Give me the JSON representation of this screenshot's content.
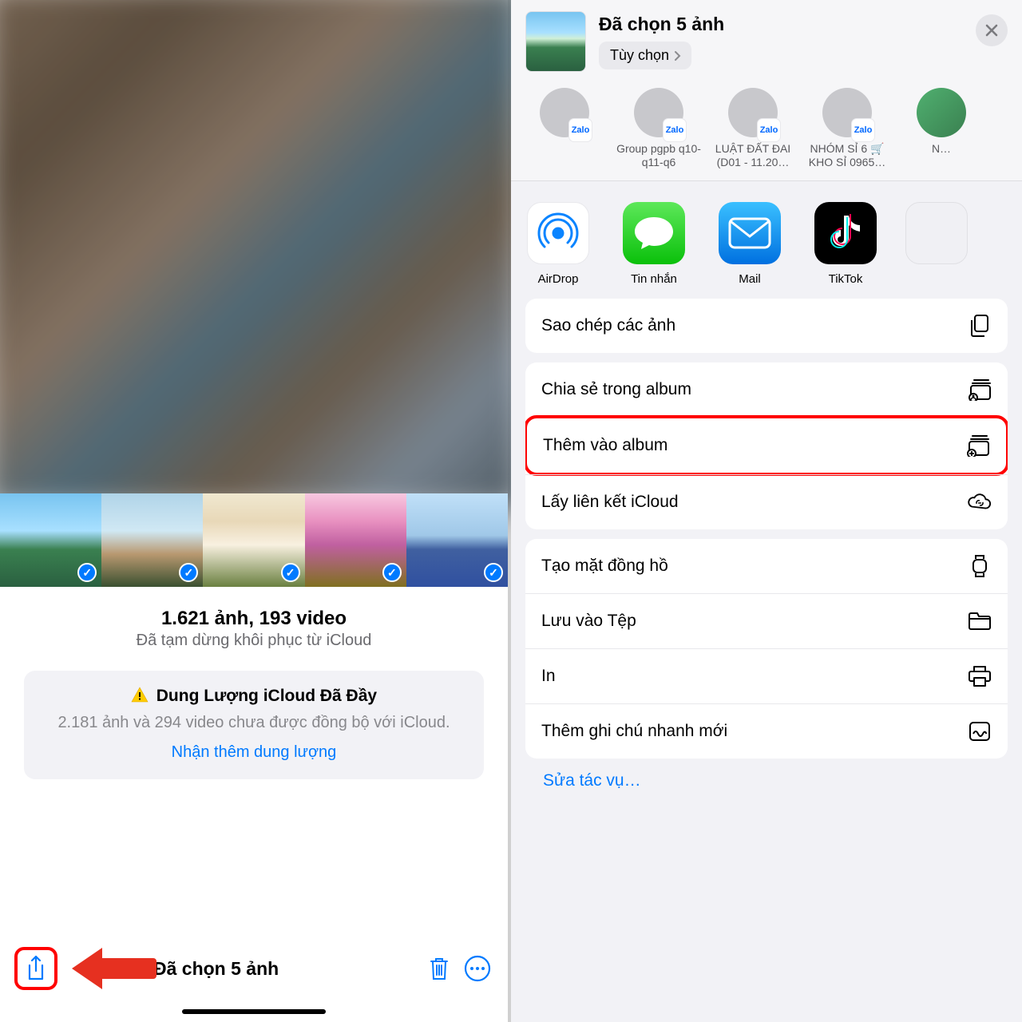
{
  "left": {
    "count_main": "1.621 ảnh, 193 video",
    "count_sub": "Đã tạm dừng khôi phục từ iCloud",
    "alert_title": "Dung Lượng iCloud Đã Đầy",
    "alert_body": "2.181 ảnh và 294 video chưa được đồng bộ với iCloud.",
    "alert_link": "Nhận thêm dung lượng",
    "bottom_title": "Đã chọn 5 ảnh"
  },
  "right": {
    "header_title": "Đã chọn 5 ảnh",
    "options_label": "Tùy chọn",
    "contacts": [
      {
        "name": " ",
        "badge": "Zalo"
      },
      {
        "name": "Group pgpb q10-q11-q6",
        "badge": "Zalo"
      },
      {
        "name": "LUẬT ĐẤT ĐAI (D01 - 11.20…",
        "badge": "Zalo"
      },
      {
        "name": "NHÓM SỈ 6 🛒 KHO SỈ 0965…",
        "badge": "Zalo"
      },
      {
        "name": "N…"
      }
    ],
    "apps": [
      {
        "name": "AirDrop"
      },
      {
        "name": "Tin nhắn"
      },
      {
        "name": "Mail"
      },
      {
        "name": "TikTok"
      }
    ],
    "actions_group1": [
      {
        "label": "Sao chép các ảnh",
        "icon": "copy"
      }
    ],
    "actions_group2": [
      {
        "label": "Chia sẻ trong album",
        "icon": "share-album"
      },
      {
        "label": "Thêm vào album",
        "icon": "add-album",
        "highlight": true
      },
      {
        "label": "Lấy liên kết iCloud",
        "icon": "icloud-link"
      }
    ],
    "actions_group3": [
      {
        "label": "Tạo mặt đồng hồ",
        "icon": "watch"
      },
      {
        "label": "Lưu vào Tệp",
        "icon": "folder"
      },
      {
        "label": "In",
        "icon": "print"
      },
      {
        "label": "Thêm ghi chú nhanh mới",
        "icon": "note"
      }
    ],
    "edit_actions_label": "Sửa tác vụ…"
  }
}
